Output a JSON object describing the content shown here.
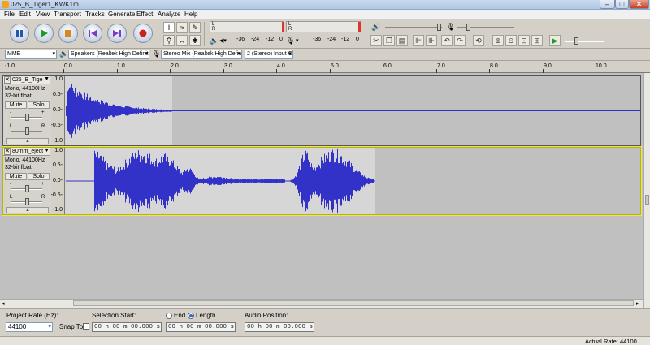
{
  "window": {
    "title": "025_B_Tiger1_KWK1m",
    "minimize": "–",
    "maximize": "□",
    "close": "✕"
  },
  "menu": [
    "File",
    "Edit",
    "View",
    "Transport",
    "Tracks",
    "Generate",
    "Effect",
    "Analyze",
    "Help"
  ],
  "meters": {
    "playback_scale": [
      "-36",
      "-24",
      "-12",
      "0"
    ],
    "record_scale": [
      "-36",
      "-24",
      "-12",
      "0"
    ],
    "left_label": "L",
    "right_label": "R"
  },
  "devices": {
    "host": "MME",
    "output": "Speakers (Realtek High Definit",
    "input": "Stereo Mix (Realtek High Defini",
    "channels": "2 (Stereo) Input C"
  },
  "ruler": [
    "-1.0",
    "0.0",
    "1.0",
    "2.0",
    "3.0",
    "4.0",
    "5.0",
    "6.0",
    "7.0",
    "8.0",
    "9.0",
    "10.0"
  ],
  "tracks": [
    {
      "name": "025_B_Tige",
      "info1": "Mono, 44100Hz",
      "info2": "32-bit float",
      "mute": "Mute",
      "solo": "Solo",
      "pan_left": "L",
      "pan_right": "R",
      "gain_minus": "-",
      "gain_plus": "+",
      "collapse": "▲",
      "scale": [
        "1.0",
        "0.5-",
        "0.0-",
        "-0.5-",
        "-1.0"
      ],
      "duration_seconds": 2.0
    },
    {
      "name": "80mm_eject",
      "info1": "Mono, 44100Hz",
      "info2": "32-bit float",
      "mute": "Mute",
      "solo": "Solo",
      "pan_left": "L",
      "pan_right": "R",
      "gain_minus": "-",
      "gain_plus": "+",
      "collapse": "▲",
      "scale": [
        "1.0",
        "0.5-",
        "0.0-",
        "-0.5-",
        "-1.0"
      ],
      "duration_seconds": 5.8
    }
  ],
  "selection": {
    "project_rate_label": "Project Rate (Hz):",
    "project_rate": "44100",
    "snap_to": "Snap To",
    "selection_start_label": "Selection Start:",
    "end_label": "End",
    "length_label": "Length",
    "audio_position_label": "Audio Position:",
    "start_time": "00 h 00 m 00.000 s",
    "end_time": "00 h 00 m 00.000 s",
    "position_time": "00 h 00 m 00.000 s"
  },
  "status": {
    "actual_rate": "Actual Rate: 44100"
  },
  "colors": {
    "wave": "#3232c8",
    "wave_bg": "#c0c0c0",
    "selected_border": "#e8e46a"
  }
}
